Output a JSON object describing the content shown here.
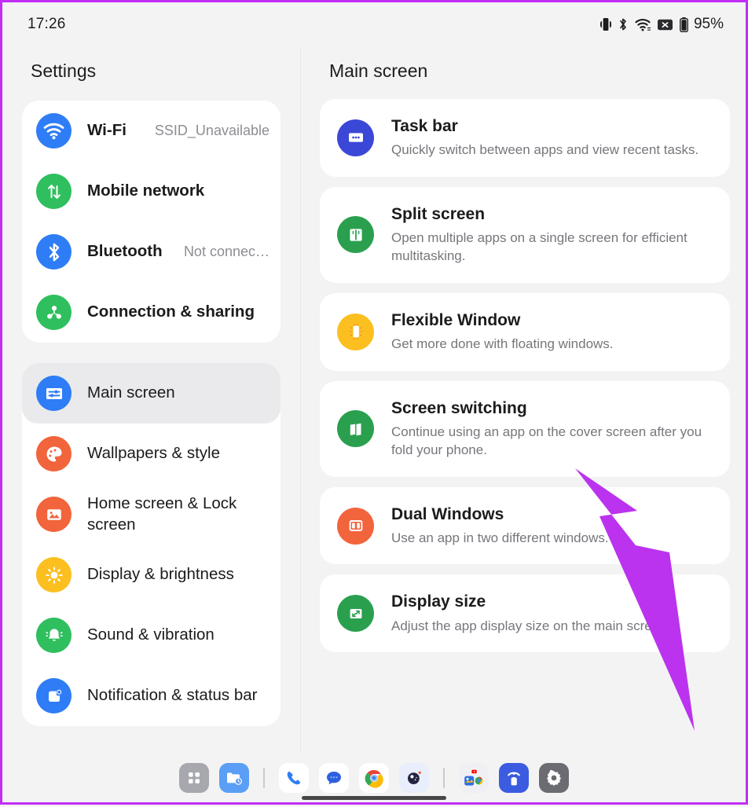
{
  "statusbar": {
    "time": "17:26",
    "battery_percent": "95%",
    "icons": [
      "vibrate-icon",
      "bluetooth-icon",
      "wifi-icon",
      "no-sim-icon",
      "battery-icon"
    ]
  },
  "sidebar": {
    "title": "Settings",
    "groups": [
      {
        "name": "connectivity",
        "items": [
          {
            "label": "Wi-Fi",
            "value": "SSID_Unavailable",
            "icon": "wifi-icon",
            "color": "#2f7df6",
            "selected": false
          },
          {
            "label": "Mobile network",
            "value": "",
            "icon": "mobile-network-icon",
            "color": "#2fbf5e",
            "selected": false
          },
          {
            "label": "Bluetooth",
            "value": "Not connec…",
            "icon": "bluetooth-icon",
            "color": "#2f7df6",
            "selected": false
          },
          {
            "label": "Connection & sharing",
            "value": "",
            "icon": "connection-sharing-icon",
            "color": "#2fbf5e",
            "selected": false
          }
        ]
      },
      {
        "name": "device",
        "items": [
          {
            "label": "Main screen",
            "value": "",
            "icon": "main-screen-icon",
            "color": "#2f7df6",
            "selected": true
          },
          {
            "label": "Wallpapers & style",
            "value": "",
            "icon": "palette-icon",
            "color": "#f2643c",
            "selected": false
          },
          {
            "label": "Home screen & Lock screen",
            "value": "",
            "icon": "image-icon",
            "color": "#f2643c",
            "selected": false
          },
          {
            "label": "Display & brightness",
            "value": "",
            "icon": "brightness-icon",
            "color": "#fcbf20",
            "selected": false
          },
          {
            "label": "Sound & vibration",
            "value": "",
            "icon": "bell-icon",
            "color": "#2fbf5e",
            "selected": false
          },
          {
            "label": "Notification & status bar",
            "value": "",
            "icon": "notification-icon",
            "color": "#2f7df6",
            "selected": false
          }
        ]
      }
    ]
  },
  "main": {
    "title": "Main screen",
    "items": [
      {
        "title": "Task bar",
        "desc": "Quickly switch between apps and view recent tasks.",
        "icon": "taskbar-icon",
        "color": "#3b47d6"
      },
      {
        "title": "Split screen",
        "desc": "Open multiple apps on a single screen for efficient multitasking.",
        "icon": "split-screen-icon",
        "color": "#2aa04f"
      },
      {
        "title": "Flexible Window",
        "desc": "Get more done with floating windows.",
        "icon": "flexible-window-icon",
        "color": "#fcbf20"
      },
      {
        "title": "Screen switching",
        "desc": "Continue using an app on the cover screen after you fold your phone.",
        "icon": "screen-switching-icon",
        "color": "#2aa04f"
      },
      {
        "title": "Dual Windows",
        "desc": "Use an app in two different windows.",
        "icon": "dual-windows-icon",
        "color": "#f2643c"
      },
      {
        "title": "Display size",
        "desc": "Adjust the app display size on the main screen.",
        "icon": "display-size-icon",
        "color": "#2aa04f"
      }
    ]
  },
  "dock": {
    "apps": [
      {
        "name": "app-drawer-icon"
      },
      {
        "name": "recent-files-icon"
      },
      {
        "name": "dock-separator"
      },
      {
        "name": "phone-icon"
      },
      {
        "name": "messages-icon"
      },
      {
        "name": "chrome-icon"
      },
      {
        "name": "camera-icon"
      },
      {
        "name": "dock-separator-2"
      },
      {
        "name": "app-folder-icon"
      },
      {
        "name": "cast-icon"
      },
      {
        "name": "settings-icon"
      }
    ]
  },
  "annotation": {
    "type": "arrow",
    "color": "#bb33ee",
    "points_to": "Screen switching"
  }
}
